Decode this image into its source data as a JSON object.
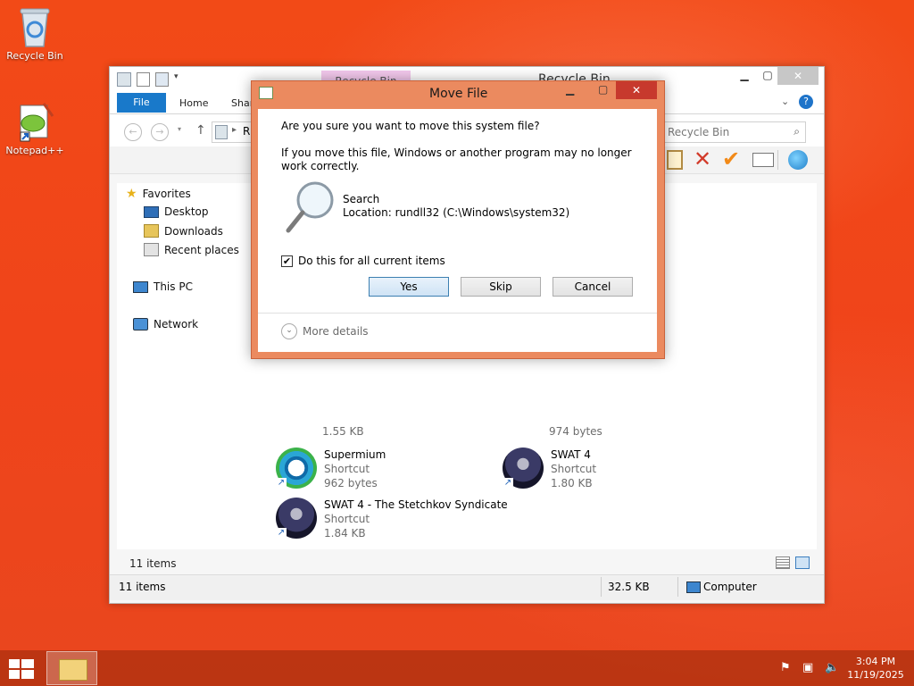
{
  "desktop": {
    "icons": [
      {
        "label": "Recycle Bin",
        "icon": "recycle-bin-icon"
      },
      {
        "label": "Notepad++",
        "icon": "notepad-plus-plus-icon"
      }
    ]
  },
  "explorer": {
    "title": "Recycle Bin",
    "contextual_tab": "Recycle Bin Tools",
    "tabs": {
      "file": "File",
      "home": "Home",
      "share": "Shar"
    },
    "address_prefix": "R",
    "search_placeholder": "Search Recycle Bin",
    "search_visible_text": "Recycle Bin",
    "nav": {
      "favorites": "Favorites",
      "desktop": "Desktop",
      "downloads": "Downloads",
      "recent": "Recent places",
      "this_pc": "This PC",
      "network": "Network"
    },
    "items": [
      {
        "name": "",
        "type": "",
        "size": "1.55 KB",
        "icon": "shortcut-icon"
      },
      {
        "name": "",
        "type": "",
        "size": "974 bytes",
        "icon": "shortcut-icon"
      },
      {
        "name": "Supermium",
        "type": "Shortcut",
        "size": "962 bytes",
        "icon": "supermium-icon"
      },
      {
        "name": "SWAT 4",
        "type": "Shortcut",
        "size": "1.80 KB",
        "icon": "swat4-icon"
      },
      {
        "name": "SWAT 4 - The Stetchkov Syndicate",
        "type": "Shortcut",
        "size": "1.84 KB",
        "icon": "swat4-icon"
      }
    ],
    "status_count": "11 items",
    "bottom": {
      "count": "11 items",
      "size": "32.5 KB",
      "location": "Computer"
    }
  },
  "dialog": {
    "title": "Move File",
    "question": "Are you sure you want to move this system file?",
    "warning": "If you move this file, Windows or another program may no longer work correctly.",
    "file_name": "Search",
    "file_location": "Location: rundll32 (C:\\Windows\\system32)",
    "checkbox_label": "Do this for all current items",
    "checkbox_checked": true,
    "buttons": {
      "yes": "Yes",
      "skip": "Skip",
      "cancel": "Cancel"
    },
    "more_details": "More details"
  },
  "taskbar": {
    "time": "3:04 PM",
    "date": "11/19/2025"
  },
  "colors": {
    "desktop_bg": "#f24a17",
    "dialog_frame": "#eb8a5f",
    "accent_blue": "#1979ca",
    "close_red": "#c7392d"
  }
}
